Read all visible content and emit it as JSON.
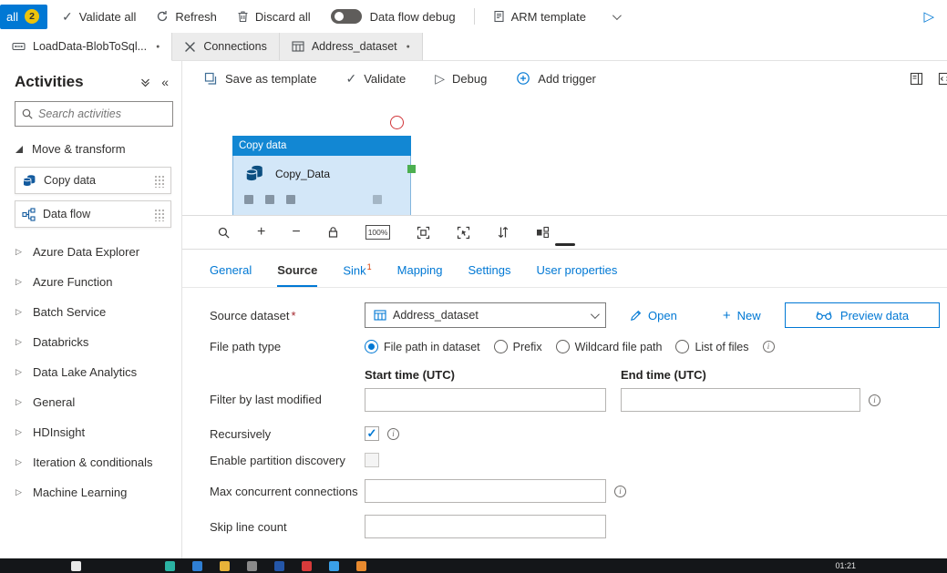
{
  "icons": {
    "check": "✓",
    "play": "▷",
    "collapsed": "▷",
    "dirty": "●",
    "collapse_panel": "«",
    "plus": "+",
    "minus": "−"
  },
  "colors": {
    "accent": "#0078d4",
    "activity_header_blue": "#1287d3",
    "activity_body_blue": "#d3e7f8",
    "error_red": "#d13438",
    "connector_green": "#4caf50",
    "publish_badge_yellow": "#ecc30b",
    "sink_superscript_orange": "#d83b01"
  },
  "top_toolbar": {
    "publish_label": "all",
    "publish_badge": "2",
    "validate_all": "Validate all",
    "refresh": "Refresh",
    "discard_all": "Discard all",
    "data_flow_debug": "Data flow debug",
    "arm_template": "ARM template"
  },
  "editor_tabs": [
    {
      "label": "LoadData-BlobToSql...",
      "dirty": true
    },
    {
      "label": "Connections",
      "dirty": false
    },
    {
      "label": "Address_dataset",
      "dirty": true
    }
  ],
  "sidebar": {
    "title": "Activities",
    "search_placeholder": "Search activities",
    "expanded_group": "Move & transform",
    "items": [
      {
        "label": "Copy data"
      },
      {
        "label": "Data flow"
      }
    ],
    "groups": [
      "Azure Data Explorer",
      "Azure Function",
      "Batch Service",
      "Databricks",
      "Data Lake Analytics",
      "General",
      "HDInsight",
      "Iteration & conditionals",
      "Machine Learning"
    ]
  },
  "canvas_toolbar": {
    "save_as_template": "Save as template",
    "validate": "Validate",
    "debug": "Debug",
    "add_trigger": "Add trigger"
  },
  "activity_node": {
    "type_label": "Copy data",
    "name": "Copy_Data"
  },
  "zoom_bar": {
    "zoom_level": "100%"
  },
  "properties": {
    "tabs": [
      {
        "label": "General"
      },
      {
        "label": "Source"
      },
      {
        "label": "Sink",
        "badge": "1"
      },
      {
        "label": "Mapping"
      },
      {
        "label": "Settings"
      },
      {
        "label": "User properties"
      }
    ],
    "active_tab": "Source",
    "source_dataset": {
      "label": "Source dataset",
      "required": "*",
      "value": "Address_dataset",
      "open": "Open",
      "new": "New",
      "preview": "Preview data"
    },
    "file_path_type": {
      "label": "File path type",
      "options": [
        {
          "label": "File path in dataset"
        },
        {
          "label": "Prefix"
        },
        {
          "label": "Wildcard file path"
        },
        {
          "label": "List of files"
        }
      ],
      "selected": "File path in dataset"
    },
    "filter_by_last_modified": {
      "label": "Filter by last modified",
      "start_header": "Start time (UTC)",
      "end_header": "End time (UTC)",
      "start_value": "",
      "end_value": ""
    },
    "recursively": {
      "label": "Recursively",
      "checked": true
    },
    "enable_partition_discovery": {
      "label": "Enable partition discovery",
      "checked": false
    },
    "max_concurrent_connections": {
      "label": "Max concurrent connections",
      "value": ""
    },
    "skip_line_count": {
      "label": "Skip line count",
      "value": ""
    }
  },
  "taskbar": {
    "time": "01:21",
    "icon_colors": [
      "#2bb3a3",
      "#2f7fd4",
      "#e8b339",
      "#8a8a8a",
      "#2456a8",
      "#d83b3b",
      "#3aa0e8",
      "#e88a2f"
    ]
  }
}
